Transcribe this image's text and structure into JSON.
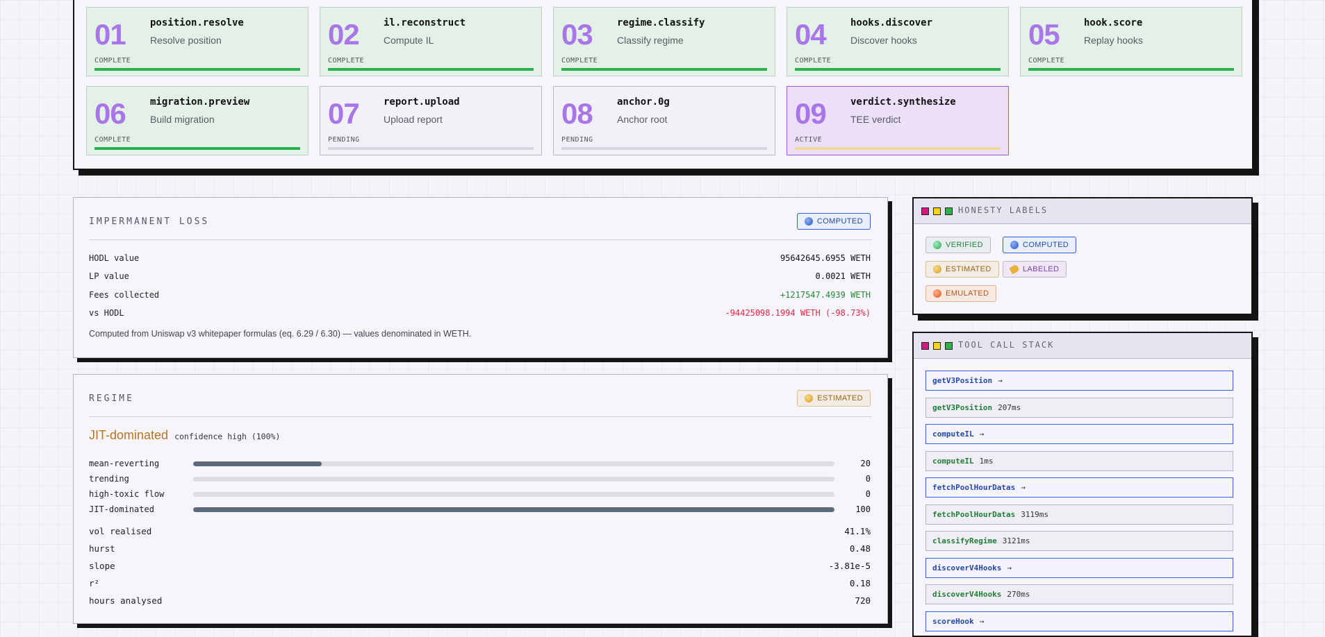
{
  "pipeline": {
    "steps": [
      {
        "num": "01",
        "name": "position.resolve",
        "desc": "Resolve position",
        "status": "COMPLETE"
      },
      {
        "num": "02",
        "name": "il.reconstruct",
        "desc": "Compute IL",
        "status": "COMPLETE"
      },
      {
        "num": "03",
        "name": "regime.classify",
        "desc": "Classify regime",
        "status": "COMPLETE"
      },
      {
        "num": "04",
        "name": "hooks.discover",
        "desc": "Discover hooks",
        "status": "COMPLETE"
      },
      {
        "num": "05",
        "name": "hook.score",
        "desc": "Replay hooks",
        "status": "COMPLETE"
      },
      {
        "num": "06",
        "name": "migration.preview",
        "desc": "Build migration",
        "status": "COMPLETE"
      },
      {
        "num": "07",
        "name": "report.upload",
        "desc": "Upload report",
        "status": "PENDING"
      },
      {
        "num": "08",
        "name": "anchor.0g",
        "desc": "Anchor root",
        "status": "PENDING"
      },
      {
        "num": "09",
        "name": "verdict.synthesize",
        "desc": "TEE verdict",
        "status": "ACTIVE"
      }
    ]
  },
  "il_card": {
    "title": "IMPERMANENT LOSS",
    "badge": "COMPUTED",
    "rows": [
      {
        "label": "HODL value",
        "value": "95642645.6955 WETH"
      },
      {
        "label": "LP value",
        "value": "0.0021 WETH"
      },
      {
        "label": "Fees collected",
        "value": "+1217547.4939 WETH"
      },
      {
        "label": "vs HODL",
        "value": "-94425098.1994 WETH (-98.73%)"
      }
    ],
    "note": "Computed from Uniswap v3 whitepaper formulas (eq. 6.29 / 6.30) — values denominated in WETH."
  },
  "regime_card": {
    "title": "REGIME",
    "badge": "ESTIMATED",
    "regime": "JIT-dominated",
    "confidence": "confidence high (100%)",
    "bars": [
      {
        "label": "mean-reverting",
        "value": 20
      },
      {
        "label": "trending",
        "value": 0
      },
      {
        "label": "high-toxic flow",
        "value": 0
      },
      {
        "label": "JIT-dominated",
        "value": 100
      }
    ],
    "bar_max": 100,
    "stats": [
      {
        "label": "vol realised",
        "value": "41.1%"
      },
      {
        "label": "hurst",
        "value": "0.48"
      },
      {
        "label": "slope",
        "value": "-3.81e-5"
      },
      {
        "label": "r²",
        "value": "0.18"
      },
      {
        "label": "hours analysed",
        "value": "720"
      }
    ]
  },
  "honesty": {
    "title": "HONESTY LABELS",
    "labels": [
      "VERIFIED",
      "COMPUTED",
      "ESTIMATED",
      "LABELED",
      "EMULATED"
    ]
  },
  "tool_stack": {
    "title": "TOOL CALL STACK",
    "arrow": "→",
    "calls": [
      {
        "fn": "getV3Position",
        "kind": "call",
        "ms": ""
      },
      {
        "fn": "getV3Position",
        "kind": "done",
        "ms": "207ms"
      },
      {
        "fn": "computeIL",
        "kind": "call",
        "ms": ""
      },
      {
        "fn": "computeIL",
        "kind": "done",
        "ms": "1ms"
      },
      {
        "fn": "fetchPoolHourDatas",
        "kind": "call",
        "ms": ""
      },
      {
        "fn": "fetchPoolHourDatas",
        "kind": "done",
        "ms": "3119ms"
      },
      {
        "fn": "classifyRegime",
        "kind": "done",
        "ms": "3121ms"
      },
      {
        "fn": "discoverV4Hooks",
        "kind": "call",
        "ms": ""
      },
      {
        "fn": "discoverV4Hooks",
        "kind": "done",
        "ms": "270ms"
      },
      {
        "fn": "scoreHook",
        "kind": "call",
        "ms": ""
      }
    ]
  },
  "colors": {
    "accent_purple": "#a876e6",
    "complete_green": "#2db14c",
    "computed_blue": "#2c5fd4",
    "estimated_orange": "#b8741a",
    "error_red": "#e2283f"
  }
}
